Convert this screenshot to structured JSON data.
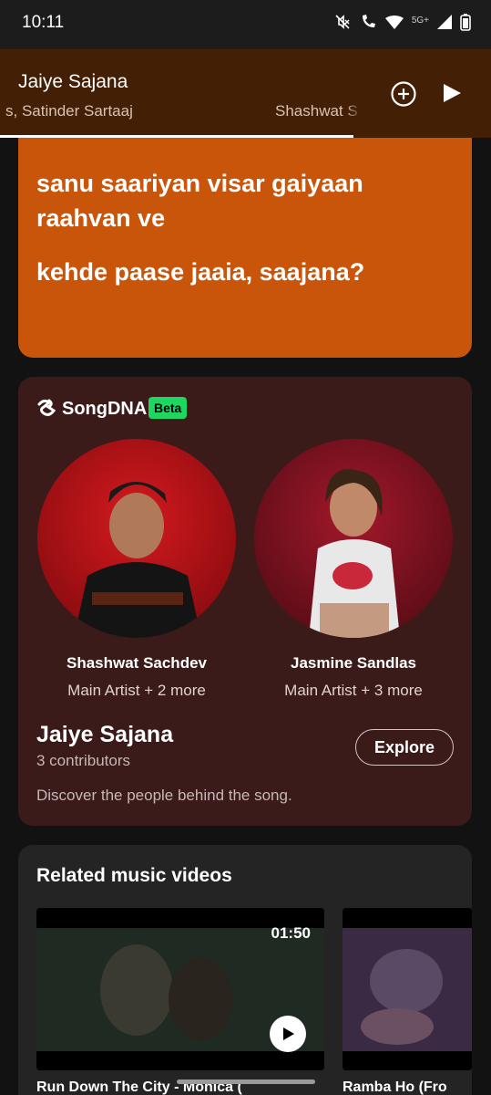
{
  "status_bar": {
    "time": "10:11",
    "network": "5G+",
    "icons": [
      "mute-icon",
      "wifi-calling-icon",
      "wifi-icon",
      "signal-icon",
      "battery-icon"
    ]
  },
  "mini_player": {
    "title": "Jaiye Sajana",
    "artists_scroll": "s, Satinder Sartaaj",
    "artists_scroll_2": "Shashwat S",
    "progress_fraction": 0.72,
    "icons": [
      "add-circle-icon",
      "play-icon"
    ]
  },
  "lyrics": {
    "lines": [
      "sanu saariyan visar gaiyaan",
      "raahvan ve",
      "kehde paase jaaia, saajana?"
    ],
    "background": "#c85509"
  },
  "song_dna": {
    "logo_text": "SongDNA",
    "badge": "Beta",
    "artists": [
      {
        "name": "Shashwat Sachdev",
        "role": "Main Artist + 2 more"
      },
      {
        "name": "Jasmine Sandlas",
        "role": "Main Artist + 3 more"
      }
    ],
    "song_title": "Jaiye Sajana",
    "contributors": "3 contributors",
    "explore_label": "Explore",
    "description": "Discover the people behind the song.",
    "background": "#3b1a1a"
  },
  "related_videos": {
    "title": "Related music videos",
    "items": [
      {
        "duration": "01:50",
        "caption": "Run Down The City - Monica ("
      },
      {
        "caption": "Ramba Ho (Fro"
      }
    ]
  },
  "colors": {
    "accent": "#1ed760",
    "brand_orange": "#c85509"
  }
}
